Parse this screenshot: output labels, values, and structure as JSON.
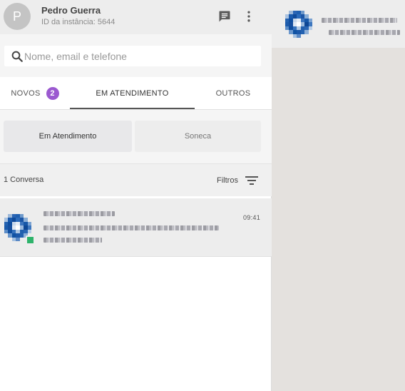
{
  "header": {
    "avatar_initial": "P",
    "user_name": "Pedro Guerra",
    "instance_label": "ID da instância: 5644",
    "icons": [
      "chat-icon",
      "more-vert-icon"
    ]
  },
  "search": {
    "placeholder": "Nome, email e telefone",
    "value": ""
  },
  "tabs": [
    {
      "label": "NOVOS",
      "badge": "2",
      "active": false
    },
    {
      "label": "EM ATENDIMENTO",
      "active": true
    },
    {
      "label": "OUTROS",
      "active": false
    }
  ],
  "subtabs": [
    {
      "label": "Em Atendimento",
      "active": true
    },
    {
      "label": "Soneca",
      "active": false
    }
  ],
  "list_info": {
    "count_label": "1 Conversa",
    "filter_label": "Filtros"
  },
  "conversations": [
    {
      "time": "09:41",
      "status_color": "#2eb36b"
    }
  ],
  "colors": {
    "accent_badge": "#9b59d0",
    "status_online": "#2eb36b",
    "panel_bg": "#e4e1de"
  }
}
